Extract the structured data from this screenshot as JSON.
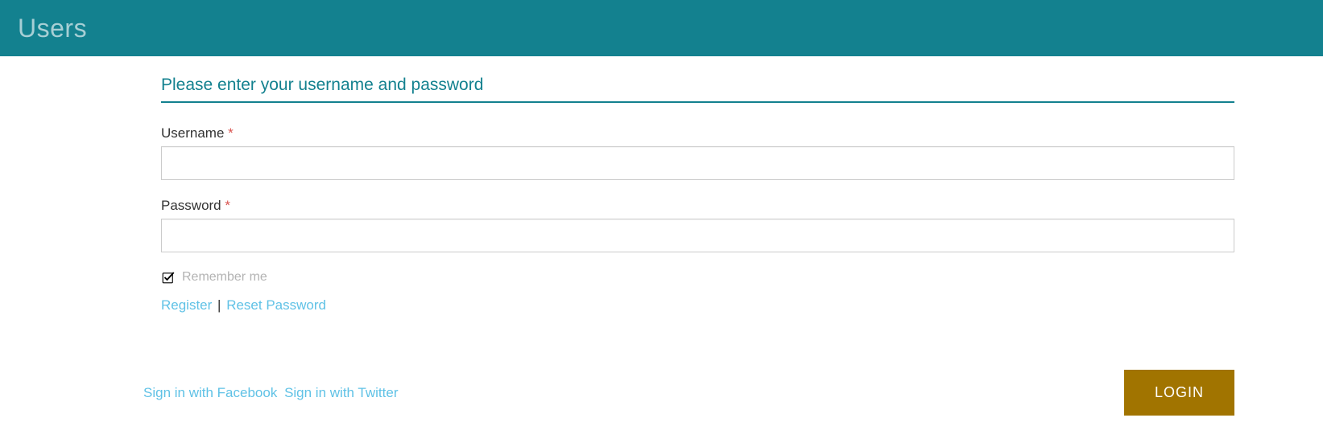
{
  "header": {
    "title": "Users"
  },
  "form": {
    "title": "Please enter your username and password",
    "username_label": "Username",
    "username_value": "",
    "password_label": "Password",
    "password_value": "",
    "required_marker": "*",
    "remember_label": "Remember me",
    "remember_checked": true,
    "register_link": "Register",
    "link_separator": "|",
    "reset_password_link": "Reset Password",
    "signin_facebook": "Sign in with Facebook",
    "signin_twitter": "Sign in with Twitter",
    "login_button": "LOGIN"
  }
}
